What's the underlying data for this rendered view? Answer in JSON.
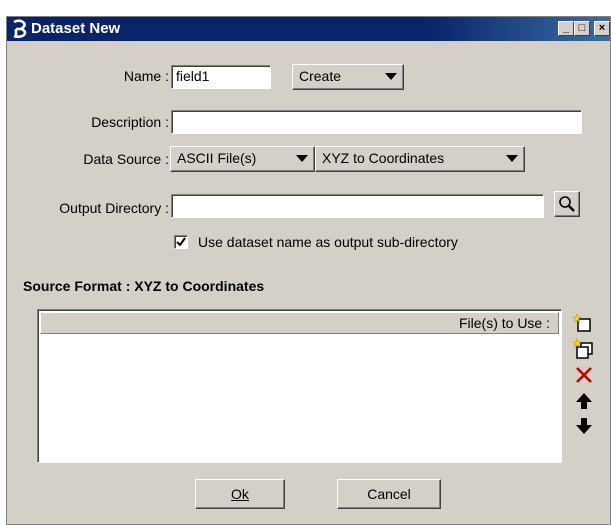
{
  "window": {
    "title": "Dataset New",
    "controls": {
      "minimize": "_",
      "maximize": "□",
      "close": "×"
    }
  },
  "form": {
    "name_label": "Name :",
    "name_value": "field1",
    "mode_value": "Create",
    "description_label": "Description :",
    "description_value": "",
    "datasource_label": "Data Source :",
    "datasource_value": "ASCII File(s)",
    "conversion_value": "XYZ to Coordinates",
    "outdir_label": "Output Directory :",
    "outdir_value": "",
    "use_name_checkbox_label": "Use dataset name as output sub-directory",
    "use_name_checked": true
  },
  "source": {
    "title": "Source Format : XYZ to Coordinates",
    "list_header": "File(s) to Use :",
    "files": []
  },
  "buttons": {
    "ok": "Ok",
    "cancel": "Cancel"
  },
  "icons": {
    "app": "app-logo-icon",
    "browse": "magnifier-icon",
    "add_file": "new-file-icon",
    "add_files": "add-multiple-icon",
    "delete": "delete-x-icon",
    "up": "arrow-up-icon",
    "down": "arrow-down-icon"
  }
}
